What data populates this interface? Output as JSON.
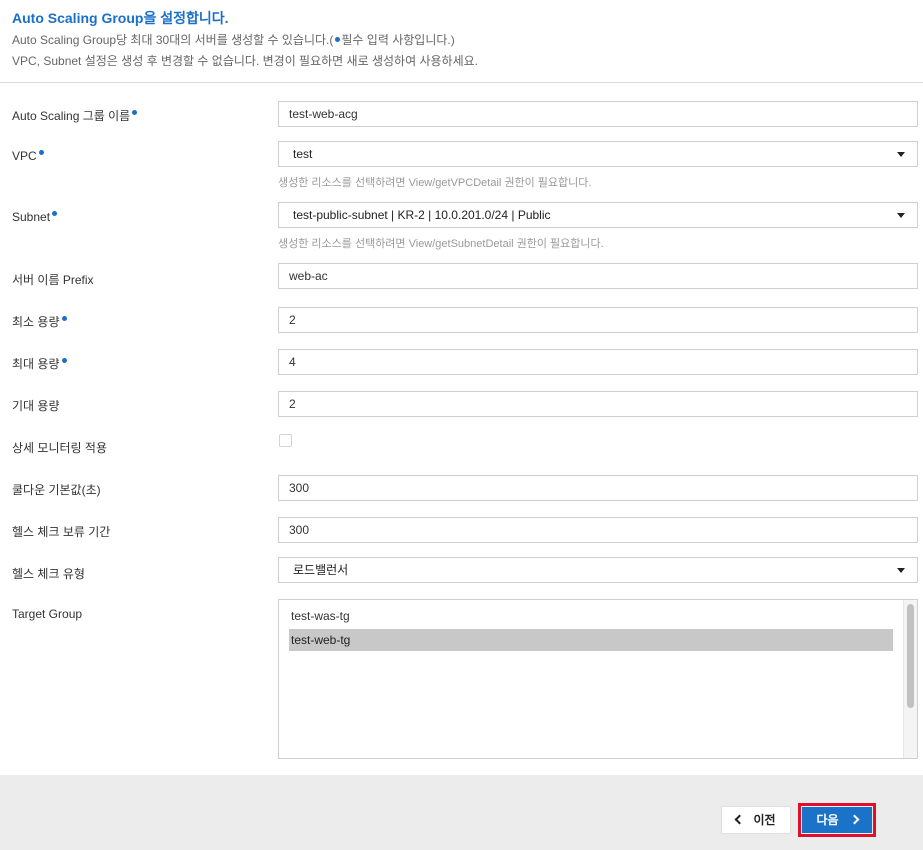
{
  "header": {
    "title": "Auto Scaling Group을 설정합니다.",
    "desc1_before": "Auto Scaling Group당 최대 30대의 서버를 생성할 수 있습니다.(",
    "desc1_after": "필수 입력 사항입니다.)",
    "desc2": "VPC, Subnet 설정은 생성 후 변경할 수 없습니다. 변경이 필요하면 새로 생성하여 사용하세요."
  },
  "form": {
    "asg_name": {
      "label": "Auto Scaling 그룹 이름",
      "value": "test-web-acg"
    },
    "vpc": {
      "label": "VPC",
      "value": "test",
      "hint": "생성한 리소스를 선택하려면 View/getVPCDetail 권한이 필요합니다."
    },
    "subnet": {
      "label": "Subnet",
      "value": "test-public-subnet | KR-2 | 10.0.201.0/24 | Public",
      "hint": "생성한 리소스를 선택하려면 View/getSubnetDetail 권한이 필요합니다."
    },
    "server_prefix": {
      "label": "서버 이름 Prefix",
      "value": "web-ac"
    },
    "min_capacity": {
      "label": "최소 용량",
      "value": "2"
    },
    "max_capacity": {
      "label": "최대 용량",
      "value": "4"
    },
    "desired_capacity": {
      "label": "기대 용량",
      "value": "2"
    },
    "detail_monitoring": {
      "label": "상세 모니터링 적용",
      "checked": false
    },
    "cooldown": {
      "label": "쿨다운 기본값(초)",
      "value": "300"
    },
    "health_grace": {
      "label": "헬스 체크 보류 기간",
      "value": "300"
    },
    "health_type": {
      "label": "헬스 체크 유형",
      "value": "로드밸런서"
    },
    "target_group": {
      "label": "Target Group",
      "options": [
        {
          "label": "test-was-tg",
          "selected": false
        },
        {
          "label": "test-web-tg",
          "selected": true
        }
      ]
    }
  },
  "footer": {
    "prev_label": "이전",
    "next_label": "다음"
  },
  "colors": {
    "accent": "#1a6fc9",
    "next_button": "#1a73c9",
    "highlight_outline": "#e0102b"
  }
}
